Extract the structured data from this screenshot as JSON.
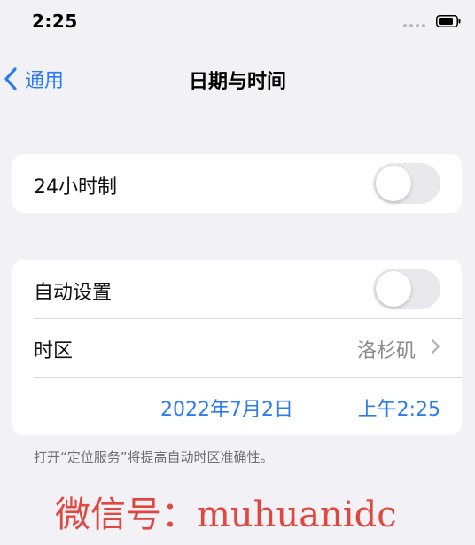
{
  "status_bar": {
    "time": "2:25",
    "signal_icon": "signal-dots-icon",
    "battery_icon": "battery-icon"
  },
  "nav": {
    "back_label": "通用",
    "title": "日期与时间",
    "back_icon": "chevron-left-icon"
  },
  "group_1": {
    "hour24_label": "24小时制",
    "hour24_on": false
  },
  "group_2": {
    "auto_set_label": "自动设置",
    "auto_set_on": false,
    "timezone_label": "时区",
    "timezone_value": "洛杉矶",
    "date": "2022年7月2日",
    "time": "上午2:25"
  },
  "footer": {
    "note": "打开“定位服务”将提高自动时区准确性。"
  },
  "watermark": {
    "text": "微信号：muhuanidc"
  },
  "colors": {
    "background": "#f2f1f6",
    "accent": "#2a7cf0",
    "toggle_off": "#e9e9ed",
    "secondary_text": "#8a8a8e",
    "watermark": "#e2473f"
  }
}
